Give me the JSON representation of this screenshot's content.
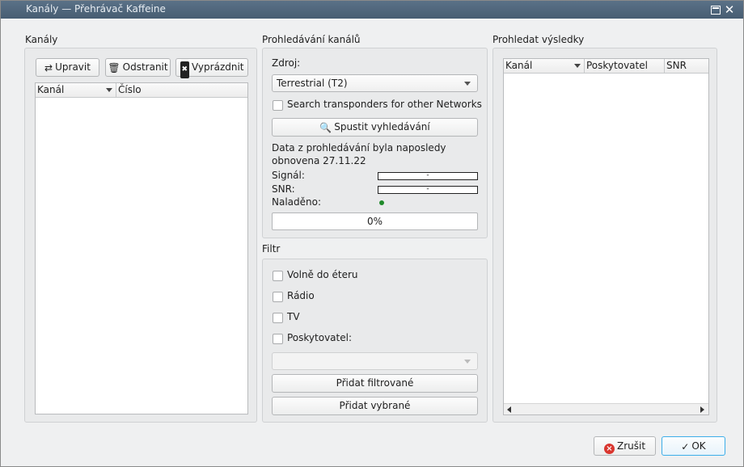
{
  "window": {
    "title": "Kanály — Přehrávač Kaffeine"
  },
  "channels": {
    "group_title": "Kanály",
    "edit_label": "Upravit",
    "remove_label": "Odstranit",
    "clear_label": "Vyprázdnit",
    "columns": [
      "Kanál",
      "Číslo"
    ]
  },
  "scan": {
    "group_title": "Prohledávání kanálů",
    "source_label": "Zdroj:",
    "source_value": "Terrestrial (T2)",
    "other_networks_label": "Search transponders for other Networks",
    "start_label": "Spustit vyhledávání",
    "last_scan_line1": "Data z prohledávání byla naposledy",
    "last_scan_line2": "obnovena 27.11.22",
    "signal_label": "Signál:",
    "signal_value": "-",
    "snr_label": "SNR:",
    "snr_value": "-",
    "tuned_label": "Naladěno:",
    "progress_text": "0%",
    "progress": 0
  },
  "filter": {
    "group_title": "Filtr",
    "free_label": "Volně do éteru",
    "radio_label": "Rádio",
    "tv_label": "TV",
    "provider_label": "Poskytovatel:",
    "add_filtered_label": "Přidat filtrované",
    "add_selected_label": "Přidat vybrané"
  },
  "results": {
    "group_title": "Prohledat výsledky",
    "columns": [
      "Kanál",
      "Poskytovatel",
      "SNR"
    ]
  },
  "dialog": {
    "cancel_label": "Zrušit",
    "ok_label": "OK"
  },
  "colors": {
    "accent": "#3daee9",
    "titlebar": "#475d72",
    "tuned_led": "#1f8a2a"
  }
}
